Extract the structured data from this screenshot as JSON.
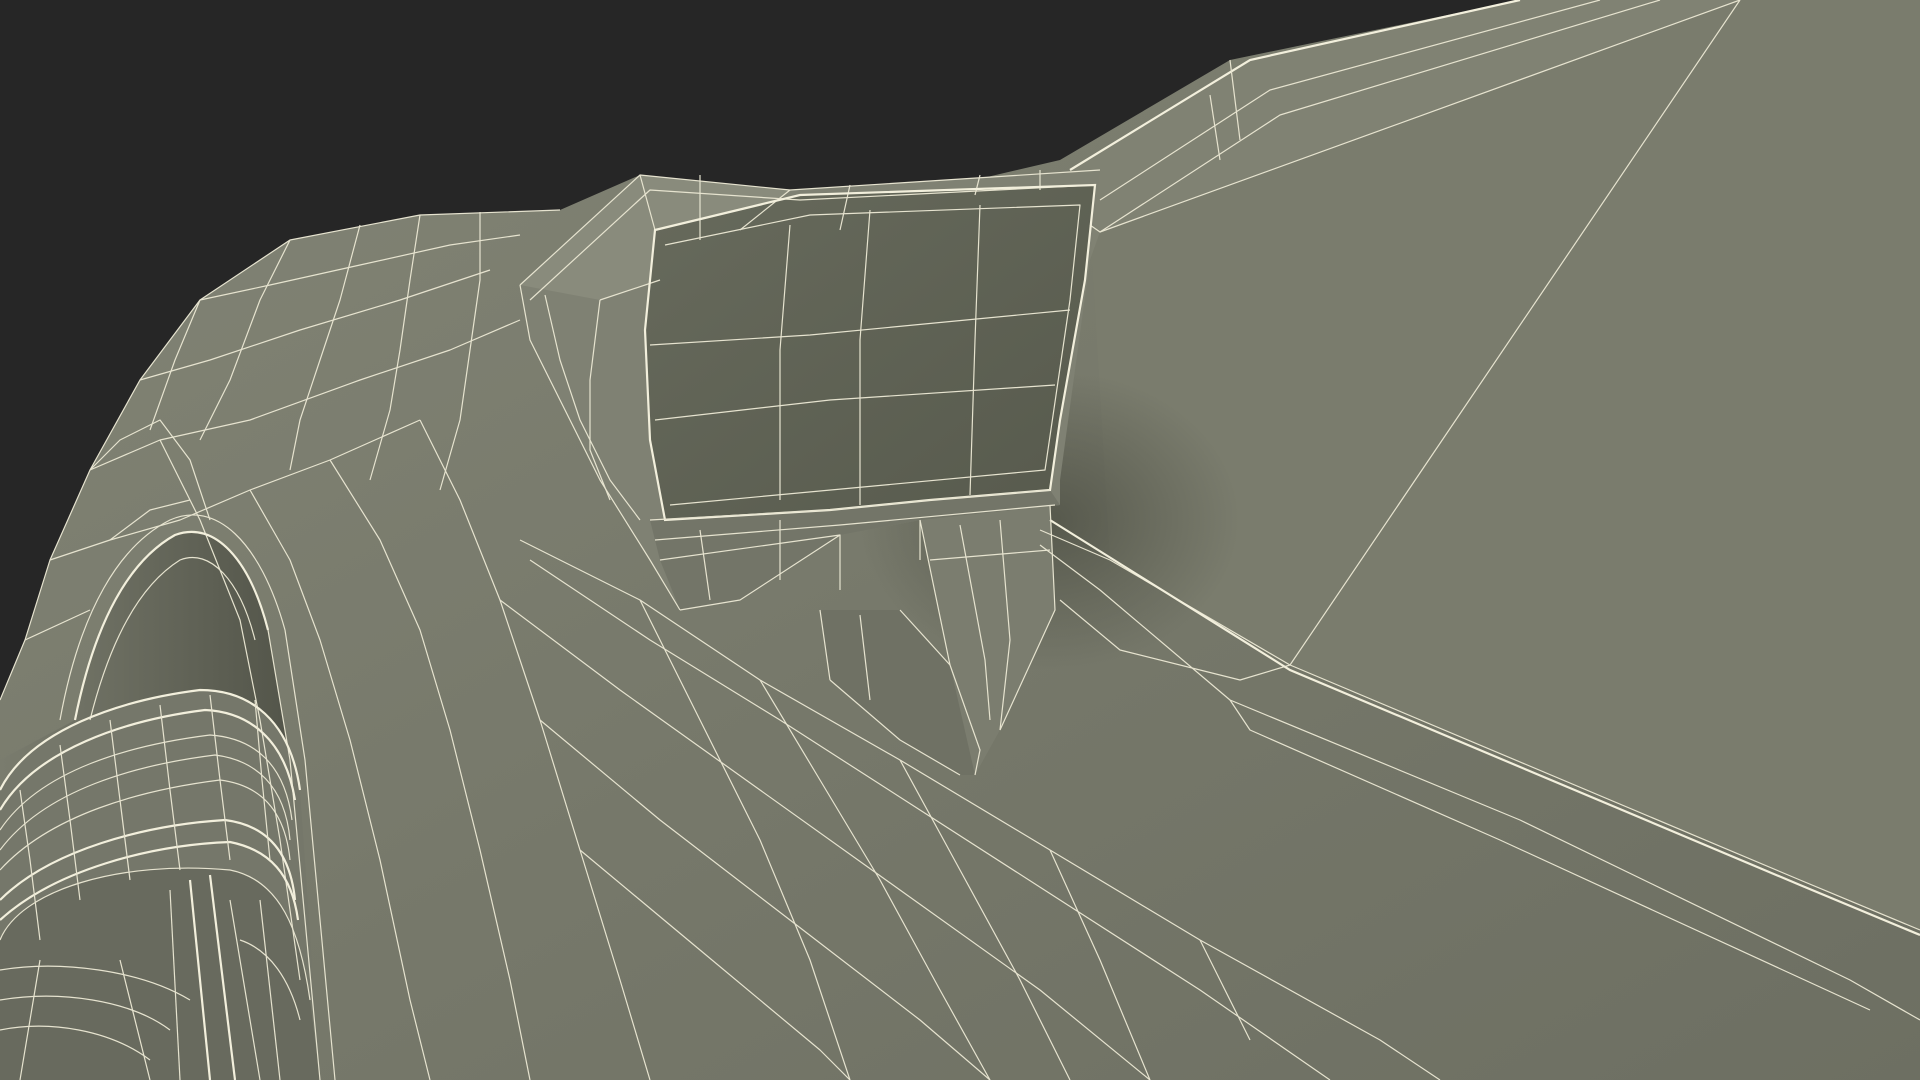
{
  "scene": {
    "subject": "wireframe-car-side-mirror",
    "colors": {
      "background": "#262626",
      "body": "#76786a",
      "body_shadow": "#5f6155",
      "body_light": "#838576",
      "mirror_glass": "#5e6053",
      "wire": "#e6e3cf"
    }
  }
}
